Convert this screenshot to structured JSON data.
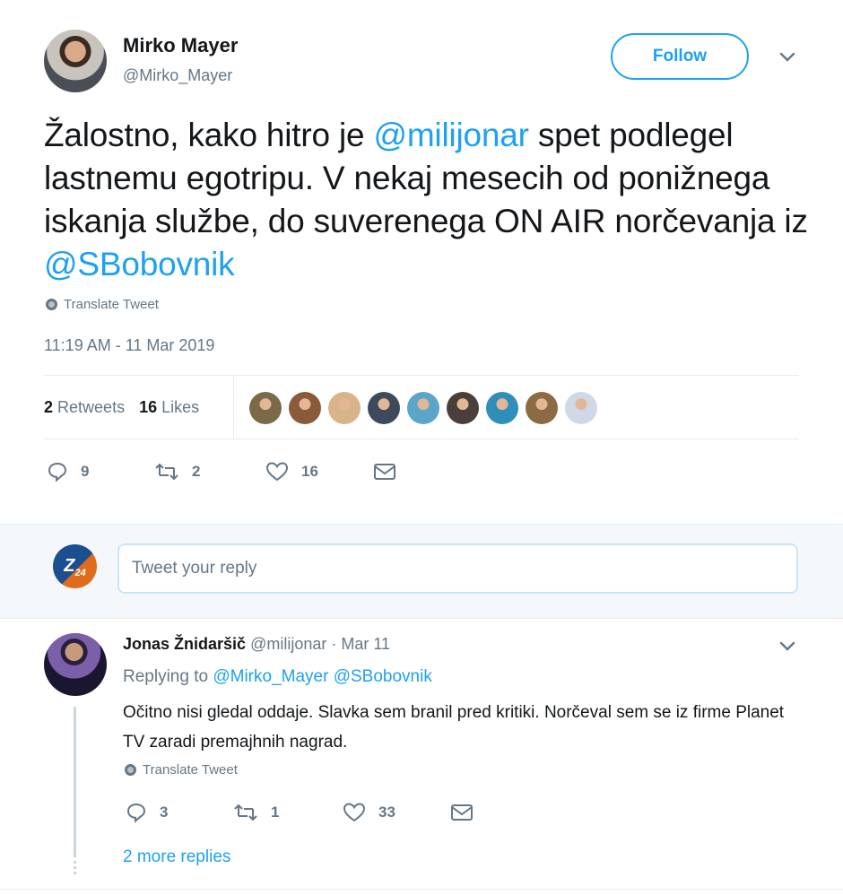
{
  "author": {
    "name": "Mirko Mayer",
    "handle": "@Mirko_Mayer"
  },
  "follow_label": "Follow",
  "tweet": {
    "text_1": "Žalostno, kako hitro je ",
    "mention_1": "@milijonar",
    "text_2": " spet podlegel lastnemu egotripu. V nekaj mesecih od ponižnega iskanja službe, do suverenega ON AIR norčevanja iz ",
    "mention_2": "@SBobovnik",
    "translate_label": "Translate Tweet",
    "timestamp": "11:19 AM - 11 Mar 2019"
  },
  "stats": {
    "retweets_count": "2",
    "retweets_label": "Retweets",
    "likes_count": "16",
    "likes_label": "Likes"
  },
  "likers": [
    "#7a6a4a",
    "#8a5a3a",
    "#d8b48a",
    "#3d4a5c",
    "#5aa6c8",
    "#4a3f3a",
    "#2f8fb8",
    "#8c6a44",
    "#cfd8e6"
  ],
  "actions": {
    "replies": "9",
    "retweets": "2",
    "likes": "16"
  },
  "reply_box": {
    "placeholder": "Tweet your reply",
    "avatar_text": "Z",
    "avatar_sub": "24"
  },
  "reply": {
    "name": "Jonas Žnidaršič",
    "handle": "@milijonar",
    "separator": " · ",
    "date": "Mar 11",
    "replying_prefix": "Replying to ",
    "replying_1": "@Mirko_Mayer",
    "replying_2": "@SBobovnik",
    "text": "Očitno nisi gledal oddaje. Slavka sem branil pred kritiki. Norčeval sem se iz firme Planet TV zaradi premajhnih nagrad.",
    "translate_label": "Translate Tweet",
    "replies": "3",
    "retweets": "1",
    "likes": "33",
    "more_replies": "2 more replies"
  },
  "colors": {
    "accent": "#1da1f2",
    "muted": "#657786",
    "text": "#14171a",
    "border": "#e6ecf0"
  }
}
